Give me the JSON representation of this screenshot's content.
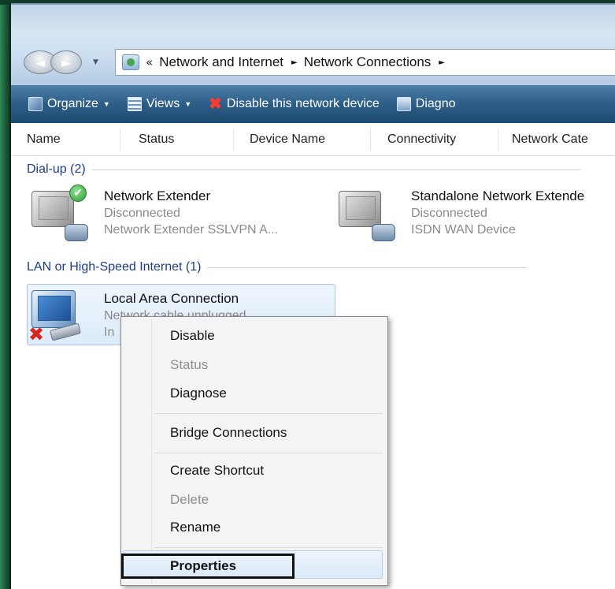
{
  "nav": {
    "back_label": "◄",
    "forward_label": "►"
  },
  "address": {
    "chevron": "«",
    "crumbs": [
      "Network and Internet",
      "Network Connections"
    ],
    "arrow": "►"
  },
  "toolbar": {
    "organize": "Organize",
    "views": "Views",
    "disable": "Disable this network device",
    "diagnose": "Diagno",
    "caret": "▼"
  },
  "columns": [
    "Name",
    "Status",
    "Device Name",
    "Connectivity",
    "Network Cate"
  ],
  "groups": {
    "dialup": {
      "title": "Dial-up (2)",
      "items": [
        {
          "name": "Network Extender",
          "status": "Disconnected",
          "device": "Network Extender SSLVPN A..."
        },
        {
          "name": "Standalone Network Extende",
          "status": "Disconnected",
          "device": "ISDN WAN Device"
        }
      ]
    },
    "lan": {
      "title": "LAN or High-Speed Internet (1)",
      "items": [
        {
          "name": "Local Area Connection",
          "status": "Network cable unplugged",
          "device": "In"
        }
      ]
    }
  },
  "context_menu": {
    "items": [
      {
        "label": "Disable",
        "enabled": true
      },
      {
        "label": "Status",
        "enabled": false
      },
      {
        "label": "Diagnose",
        "enabled": true
      },
      {
        "label": "Bridge Connections",
        "enabled": true
      },
      {
        "label": "Create Shortcut",
        "enabled": true
      },
      {
        "label": "Delete",
        "enabled": false
      },
      {
        "label": "Rename",
        "enabled": true
      },
      {
        "label": "Properties",
        "enabled": true,
        "highlighted": true
      }
    ]
  },
  "icons": {
    "check": "✔",
    "red_x": "✖",
    "disable": "✖"
  },
  "colors": {
    "toolbar": "#2d5e87",
    "group_heading": "#1e3c8c",
    "disabled_text": "#8e8e8e"
  }
}
